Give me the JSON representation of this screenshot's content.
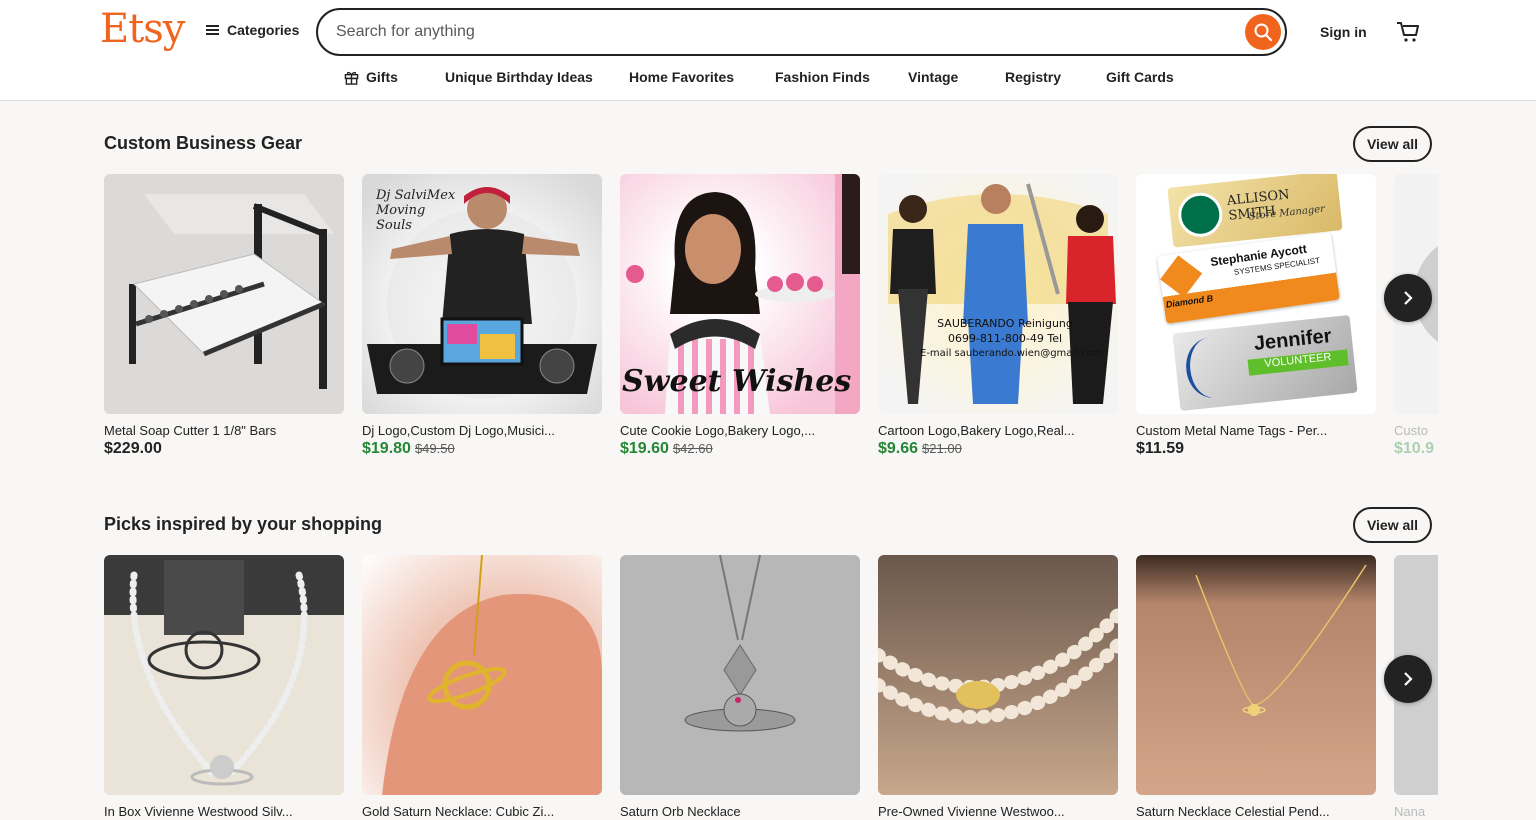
{
  "header": {
    "logo": "Etsy",
    "categories_label": "Categories",
    "search_placeholder": "Search for anything",
    "signin_label": "Sign in"
  },
  "nav": {
    "items": [
      {
        "label": "Gifts",
        "icon": "gift-icon"
      },
      {
        "label": "Unique Birthday Ideas"
      },
      {
        "label": "Home Favorites"
      },
      {
        "label": "Fashion Finds"
      },
      {
        "label": "Vintage"
      },
      {
        "label": "Registry"
      },
      {
        "label": "Gift Cards"
      }
    ]
  },
  "sections": [
    {
      "title": "Custom Business Gear",
      "view_all": "View all",
      "items": [
        {
          "title": "Metal Soap Cutter 1 1/8\" Bars",
          "price": "$229.00",
          "original_price": ""
        },
        {
          "title": "Dj Logo,Custom Dj Logo,Musici...",
          "price": "$19.80",
          "original_price": "$49.50"
        },
        {
          "title": "Cute Cookie Logo,Bakery Logo,...",
          "price": "$19.60",
          "original_price": "$42.60"
        },
        {
          "title": "Cartoon Logo,Bakery Logo,Real...",
          "price": "$9.66",
          "original_price": "$21.00"
        },
        {
          "title": "Custom Metal Name Tags - Per...",
          "price": "$11.59",
          "original_price": ""
        },
        {
          "title": "Custo",
          "price": "$10.9",
          "original_price": ""
        }
      ]
    },
    {
      "title": "Picks inspired by your shopping",
      "view_all": "View all",
      "items": [
        {
          "title": "In Box Vivienne Westwood Silv..."
        },
        {
          "title": "Gold Saturn Necklace: Cubic Zi..."
        },
        {
          "title": "Saturn Orb Necklace"
        },
        {
          "title": "Pre-Owned Vivienne Westwoo..."
        },
        {
          "title": "Saturn Necklace Celestial Pend..."
        },
        {
          "title": "Nana"
        }
      ]
    }
  ],
  "image_text": {
    "dj_name": "Dj SalviMex Moving Souls",
    "sweet": "Sweet Wishes",
    "cleaning_name": "SAUBERANDO Reinigung",
    "cleaning_phone": "0699-811-800-49 Tel",
    "cleaning_email": "E-mail sauberando.wien@gmail.com",
    "tag1_name": "ALLISON SMITH",
    "tag1_role": "Store Manager",
    "tag2_name": "Stephanie Aycott",
    "tag2_role": "SYSTEMS SPECIALIST",
    "tag2_company": "Diamond B",
    "tag3_name": "Jennifer",
    "tag3_role": "VOLUNTEER"
  },
  "colors": {
    "brand": "#f1641e",
    "sale_price": "#258635",
    "text": "#222222"
  }
}
